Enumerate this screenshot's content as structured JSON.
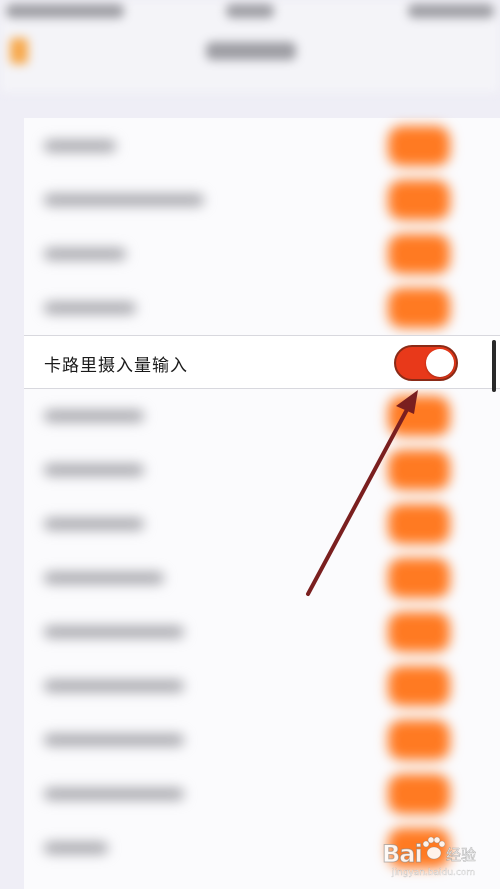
{
  "settings_row": {
    "label": "卡路里摄入量输入",
    "toggle_state": "on"
  },
  "colors": {
    "toggle_on": "#e8391a",
    "blurred_toggle": "#ff7a22",
    "arrow": "#7a1f1f",
    "background": "#efeef6"
  },
  "watermark": {
    "brand": "Bai",
    "suffix": "经验",
    "url": "jingyan.baidu.com"
  }
}
